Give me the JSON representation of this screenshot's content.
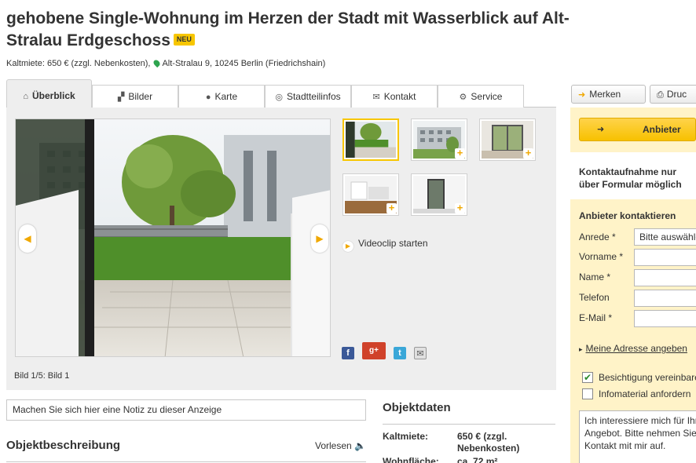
{
  "header": {
    "title": "gehobene Single-Wohnung im Herzen der Stadt mit Wasserblick auf Alt-Stralau Erdgeschoss",
    "badge": "NEU",
    "rent_text": "Kaltmiete: 650 € (zzgl. Nebenkosten),",
    "address": "Alt-Stralau 9, 10245 Berlin (Friedrichshain)"
  },
  "tabs": [
    {
      "label": "Überblick",
      "icon": "home-icon"
    },
    {
      "label": "Bilder",
      "icon": "images-icon"
    },
    {
      "label": "Karte",
      "icon": "map-pin-icon"
    },
    {
      "label": "Stadtteilinfos",
      "icon": "target-icon"
    },
    {
      "label": "Kontakt",
      "icon": "envelope-icon"
    },
    {
      "label": "Service",
      "icon": "gears-icon"
    }
  ],
  "actions": {
    "merken": "Merken",
    "drucken": "Druc"
  },
  "gallery": {
    "bild_info": "Bild 1/5: Bild 1",
    "video_label": "Videoclip starten",
    "thumb_count": 5
  },
  "note_placeholder": "Machen Sie sich hier eine Notiz zu dieser Anzeige",
  "objektbeschreibung": {
    "title": "Objektbeschreibung",
    "vorlesen": "Vorlesen"
  },
  "objektdaten": {
    "title": "Objektdaten",
    "rows": [
      {
        "label": "Kaltmiete:",
        "value": "650 € (zzgl. Nebenkosten)"
      },
      {
        "label": "Wohnfläche:",
        "value": "ca. 72 m²"
      }
    ]
  },
  "contact": {
    "anbieter_button": "Anbieter",
    "note": "Kontaktaufnahme nur über Formular möglich",
    "form_title": "Anbieter kontaktieren",
    "fields": [
      {
        "label": "Anrede *",
        "value": "Bitte auswählen"
      },
      {
        "label": "Vorname *",
        "value": ""
      },
      {
        "label": "Name *",
        "value": ""
      },
      {
        "label": "Telefon",
        "value": ""
      },
      {
        "label": "E-Mail *",
        "value": ""
      }
    ],
    "address_link": "Meine Adresse angeben",
    "checkboxes": [
      {
        "label": "Besichtigung vereinbaren",
        "checked": true
      },
      {
        "label": "Infomaterial anfordern",
        "checked": false
      }
    ],
    "message": "Ich interessiere mich für Ihr\nAngebot. Bitte nehmen Sie\nKontakt mit mir auf."
  },
  "colors": {
    "accent": "#f7c600",
    "panel": "#eeeeee",
    "sidebar": "#fff3c8"
  }
}
